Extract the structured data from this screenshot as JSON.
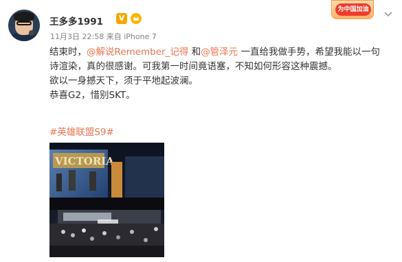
{
  "user": {
    "name": "王多多1991",
    "verified_mark": "V"
  },
  "meta": {
    "date": "11月3日 22:58",
    "source_prefix": "来自",
    "source": "iPhone 7"
  },
  "topic_chip": {
    "label": "为中国加油"
  },
  "post": {
    "line1_a": "结束时，",
    "mention1": "@解说Remember_记得",
    "line1_b": " 和",
    "mention2": "@管泽元",
    "line1_c": " 一直给我做手势，希望我能以一句",
    "line2": "诗渲染，真的很感谢。可我第一时间竟语塞，不知如何形容这种震撼。",
    "line3": "欲以一身撼天下，须于平地起波澜。",
    "line4": "恭喜G2，惜别SKT。",
    "hashtag": "#英雄联盟S9#"
  },
  "photo": {
    "banner_text": "VICTORIA"
  },
  "colors": {
    "link": "#eb7350",
    "meta": "#808080",
    "text": "#333333",
    "verified": "#f7a700"
  }
}
